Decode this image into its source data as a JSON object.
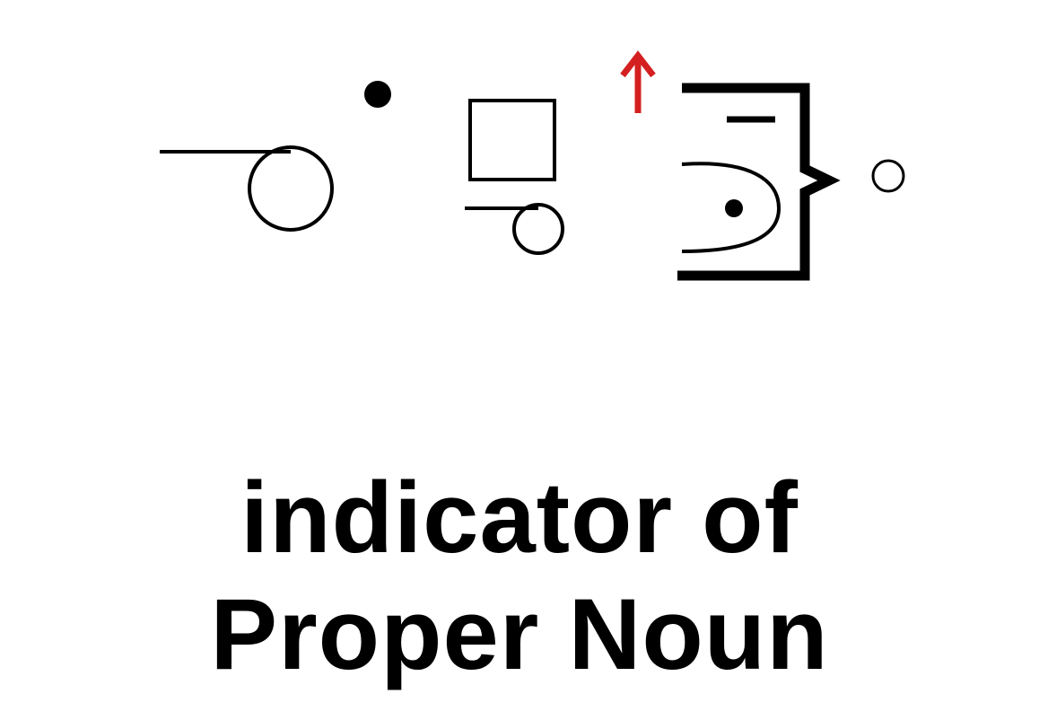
{
  "caption": {
    "line1": "indicator of",
    "line2": "Proper Noun"
  },
  "symbols": [
    {
      "name": "line-with-circle-icon"
    },
    {
      "name": "dot-icon"
    },
    {
      "name": "square-over-small-line-circle-icon"
    },
    {
      "name": "up-arrow-icon",
      "color": "#d42020"
    },
    {
      "name": "bracket-half-circle-dot-icon"
    },
    {
      "name": "small-circle-icon"
    }
  ],
  "colors": {
    "ink": "#000000",
    "accent": "#d42020",
    "background": "#ffffff"
  }
}
